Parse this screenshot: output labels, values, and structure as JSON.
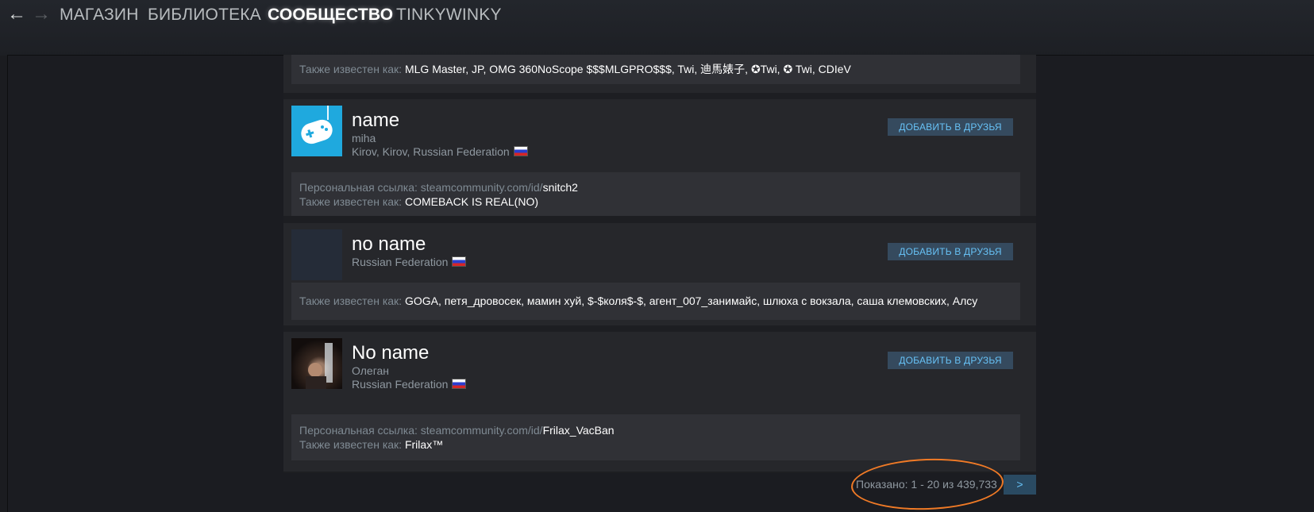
{
  "nav": {
    "back_icon": "arrow-left-icon",
    "forward_icon": "arrow-right-icon",
    "links": [
      "МАГАЗИН",
      "БИБЛИОТЕКА",
      "СООБЩЕСТВО",
      "TINKYWINKY"
    ],
    "active": "СООБЩЕСТВО"
  },
  "labels": {
    "aka": "Также известен как:",
    "profile_url": "Персональная ссылка:",
    "url_prefix": "steamcommunity.com/id/",
    "add_friend": "ДОБАВИТЬ В ДРУЗЬЯ"
  },
  "top_card": {
    "aka": "MLG Master, JP, OMG 360NoScope $$$MLGPRO$$$, Twi, 迪馬婊子, ✪Twi, ✪ Twi, CDIeV"
  },
  "results": [
    {
      "name": "name",
      "real_name": "miha",
      "location": "Kirov, Kirov, Russian Federation",
      "avatar": "gamepad-icon",
      "url_id": "snitch2",
      "aka": "COMEBACK IS REAL(NO)"
    },
    {
      "name": "no name",
      "location": "Russian Federation",
      "avatar": "blank-avatar",
      "aka": "GOGA, петя_дровосек, мамин хуй, $-$коля$-$, агент_007_занимайс, шлюха с вокзала, саша клемовских, Алсу"
    },
    {
      "name": "No name",
      "real_name": "Олеган",
      "location": "Russian Federation",
      "avatar": "photo-avatar",
      "url_id": "Frilax_VacBan",
      "aka": "Frilax™"
    }
  ],
  "pager": {
    "text": "Показано: 1 - 20 из 439,733",
    "next": ">"
  },
  "colors": {
    "accent": "#67c1f5",
    "button_bg": "#354a5e",
    "annotation": "#f07a26"
  }
}
